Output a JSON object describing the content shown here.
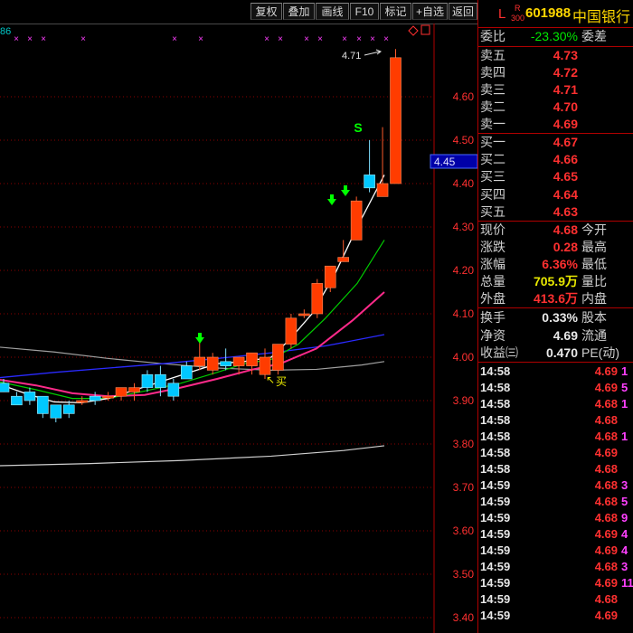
{
  "toolbar": {
    "buttons": [
      "复权",
      "叠加",
      "画线",
      "F10",
      "标记",
      "+自选",
      "返回"
    ]
  },
  "chart": {
    "indicator_fragment": "86",
    "price_axis": [
      "4.60",
      "4.50",
      "4.40",
      "4.30",
      "4.20",
      "4.10",
      "4.00",
      "3.90",
      "3.80",
      "3.70",
      "3.60",
      "3.50",
      "3.40"
    ],
    "current_price_tag": "4.45",
    "high_annotation": "4.71",
    "buy_label": "买",
    "sell_label": "S",
    "colors": {
      "up": "#ff3c00",
      "down": "#00c8ff",
      "grid": "#8b0000",
      "ma5": "#ffffff",
      "ma10": "#00cc00",
      "ma20": "#ff2a8a",
      "ma60": "#2a2aff",
      "ma120": "#a0a0a0",
      "ma250": "#d0d0d0",
      "marker": "#ff40ff",
      "signal": "#00ff00"
    },
    "candles": [
      {
        "o": 3.94,
        "h": 3.95,
        "l": 3.92,
        "c": 3.92
      },
      {
        "o": 3.91,
        "h": 3.92,
        "l": 3.89,
        "c": 3.89
      },
      {
        "o": 3.92,
        "h": 3.93,
        "l": 3.89,
        "c": 3.9
      },
      {
        "o": 3.91,
        "h": 3.91,
        "l": 3.86,
        "c": 3.87
      },
      {
        "o": 3.89,
        "h": 3.89,
        "l": 3.85,
        "c": 3.86
      },
      {
        "o": 3.89,
        "h": 3.9,
        "l": 3.86,
        "c": 3.87
      },
      {
        "o": 3.9,
        "h": 3.91,
        "l": 3.89,
        "c": 3.9
      },
      {
        "o": 3.91,
        "h": 3.92,
        "l": 3.89,
        "c": 3.9
      },
      {
        "o": 3.91,
        "h": 3.92,
        "l": 3.9,
        "c": 3.91
      },
      {
        "o": 3.91,
        "h": 3.93,
        "l": 3.9,
        "c": 3.93
      },
      {
        "o": 3.92,
        "h": 3.94,
        "l": 3.9,
        "c": 3.93
      },
      {
        "o": 3.96,
        "h": 3.97,
        "l": 3.92,
        "c": 3.93
      },
      {
        "o": 3.96,
        "h": 3.98,
        "l": 3.91,
        "c": 3.93
      },
      {
        "o": 3.94,
        "h": 3.95,
        "l": 3.9,
        "c": 3.91
      },
      {
        "o": 3.98,
        "h": 3.99,
        "l": 3.95,
        "c": 3.95
      },
      {
        "o": 3.98,
        "h": 4.05,
        "l": 3.97,
        "c": 4.0
      },
      {
        "o": 3.97,
        "h": 4.01,
        "l": 3.96,
        "c": 4.0
      },
      {
        "o": 3.99,
        "h": 4.02,
        "l": 3.97,
        "c": 3.98
      },
      {
        "o": 3.98,
        "h": 4.0,
        "l": 3.96,
        "c": 4.0
      },
      {
        "o": 3.98,
        "h": 4.01,
        "l": 3.96,
        "c": 4.01
      },
      {
        "o": 3.96,
        "h": 4.02,
        "l": 3.95,
        "c": 4.0
      },
      {
        "o": 3.97,
        "h": 4.03,
        "l": 3.96,
        "c": 4.03
      },
      {
        "o": 4.03,
        "h": 4.1,
        "l": 4.02,
        "c": 4.09
      },
      {
        "o": 4.1,
        "h": 4.11,
        "l": 4.09,
        "c": 4.1
      },
      {
        "o": 4.1,
        "h": 4.18,
        "l": 4.09,
        "c": 4.17
      },
      {
        "o": 4.16,
        "h": 4.21,
        "l": 4.15,
        "c": 4.21
      },
      {
        "o": 4.22,
        "h": 4.27,
        "l": 4.22,
        "c": 4.23
      },
      {
        "o": 4.27,
        "h": 4.37,
        "l": 4.27,
        "c": 4.36
      },
      {
        "o": 4.42,
        "h": 4.5,
        "l": 4.38,
        "c": 4.39
      },
      {
        "o": 4.37,
        "h": 4.53,
        "l": 4.37,
        "c": 4.4
      },
      {
        "o": 4.4,
        "h": 4.71,
        "l": 4.4,
        "c": 4.69
      }
    ]
  },
  "quote": {
    "market_tag": "L",
    "r_tag": "R",
    "sub_tag": "300",
    "code": "601988",
    "name": "中国银行",
    "weibi_label": "委比",
    "weibi_value": "-23.30%",
    "weicha_label": "委差",
    "asks": [
      {
        "label": "卖五",
        "price": "4.73"
      },
      {
        "label": "卖四",
        "price": "4.72"
      },
      {
        "label": "卖三",
        "price": "4.71"
      },
      {
        "label": "卖二",
        "price": "4.70"
      },
      {
        "label": "卖一",
        "price": "4.69"
      }
    ],
    "bids": [
      {
        "label": "买一",
        "price": "4.67"
      },
      {
        "label": "买二",
        "price": "4.66"
      },
      {
        "label": "买三",
        "price": "4.65"
      },
      {
        "label": "买四",
        "price": "4.64"
      },
      {
        "label": "买五",
        "price": "4.63"
      }
    ],
    "stats": [
      {
        "label": "现价",
        "value": "4.68",
        "color": "#ff3030",
        "label2": "今开"
      },
      {
        "label": "涨跌",
        "value": "0.28",
        "color": "#ff3030",
        "label2": "最高"
      },
      {
        "label": "涨幅",
        "value": "6.36%",
        "color": "#ff3030",
        "label2": "最低"
      },
      {
        "label": "总量",
        "value": "705.9万",
        "color": "#e8e800",
        "label2": "量比"
      },
      {
        "label": "外盘",
        "value": "413.6万",
        "color": "#ff3030",
        "label2": "内盘"
      }
    ],
    "stats2": [
      {
        "label": "换手",
        "value": "0.33%",
        "color": "#e8e8e8",
        "label2": "股本"
      },
      {
        "label": "净资",
        "value": "4.69",
        "color": "#e8e8e8",
        "label2": "流通"
      },
      {
        "label": "收益㈢",
        "value": "0.470",
        "color": "#e8e8e8",
        "label2": "PE(动)"
      }
    ],
    "ticks": [
      {
        "time": "14:58",
        "price": "4.69",
        "vol": "1",
        "vcolor": "#ff40ff"
      },
      {
        "time": "14:58",
        "price": "4.69",
        "vol": "5",
        "vcolor": "#ff40ff"
      },
      {
        "time": "14:58",
        "price": "4.68",
        "vol": "1",
        "vcolor": "#ff40ff"
      },
      {
        "time": "14:58",
        "price": "4.68",
        "vol": "",
        "vcolor": "#ff40ff"
      },
      {
        "time": "14:58",
        "price": "4.68",
        "vol": "1",
        "vcolor": "#ff40ff"
      },
      {
        "time": "14:58",
        "price": "4.69",
        "vol": "",
        "vcolor": "#ff40ff"
      },
      {
        "time": "14:58",
        "price": "4.68",
        "vol": "",
        "vcolor": "#ff40ff"
      },
      {
        "time": "14:59",
        "price": "4.68",
        "vol": "3",
        "vcolor": "#ff40ff"
      },
      {
        "time": "14:59",
        "price": "4.68",
        "vol": "5",
        "vcolor": "#ff40ff"
      },
      {
        "time": "14:59",
        "price": "4.68",
        "vol": "9",
        "vcolor": "#ff40ff"
      },
      {
        "time": "14:59",
        "price": "4.69",
        "vol": "4",
        "vcolor": "#ff40ff"
      },
      {
        "time": "14:59",
        "price": "4.69",
        "vol": "4",
        "vcolor": "#ff40ff"
      },
      {
        "time": "14:59",
        "price": "4.68",
        "vol": "3",
        "vcolor": "#ff40ff"
      },
      {
        "time": "14:59",
        "price": "4.69",
        "vol": "11",
        "vcolor": "#ff40ff"
      },
      {
        "time": "14:59",
        "price": "4.68",
        "vol": "",
        "vcolor": "#ff40ff"
      },
      {
        "time": "14:59",
        "price": "4.69",
        "vol": "",
        "vcolor": "#ff40ff"
      }
    ]
  }
}
